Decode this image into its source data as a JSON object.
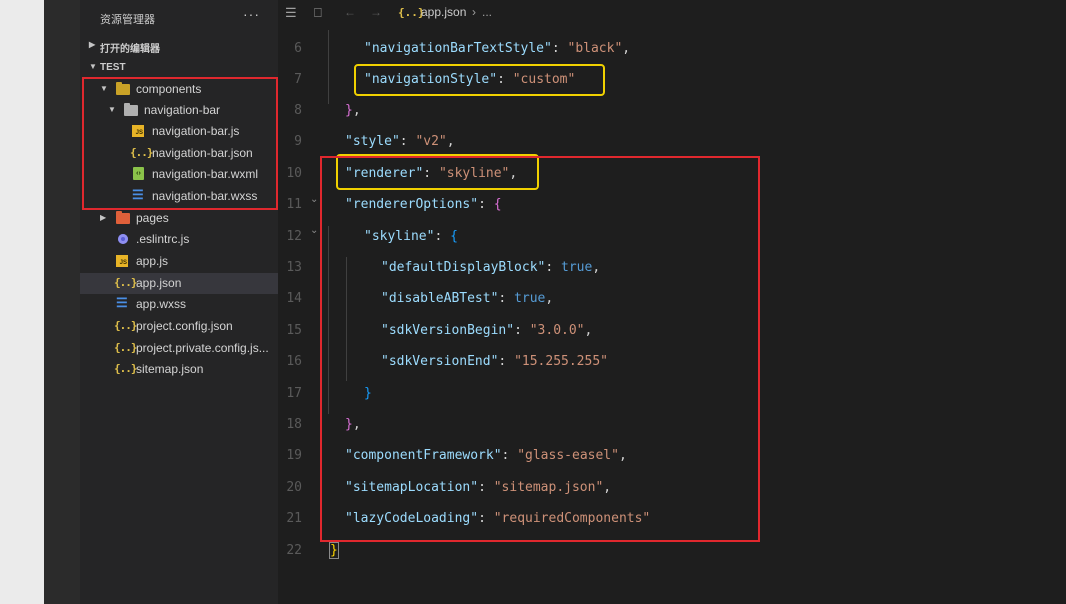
{
  "sidebar": {
    "title": "资源管理器",
    "more": "···",
    "open_editors": "打开的编辑器",
    "project": "TEST",
    "items": [
      {
        "name": "components"
      },
      {
        "name": "navigation-bar"
      },
      {
        "name": "navigation-bar.js"
      },
      {
        "name": "navigation-bar.json"
      },
      {
        "name": "navigation-bar.wxml"
      },
      {
        "name": "navigation-bar.wxss"
      },
      {
        "name": "pages"
      },
      {
        "name": ".eslintrc.js"
      },
      {
        "name": "app.js"
      },
      {
        "name": "app.json"
      },
      {
        "name": "app.wxss"
      },
      {
        "name": "project.config.json"
      },
      {
        "name": "project.private.config.js..."
      },
      {
        "name": "sitemap.json"
      }
    ]
  },
  "breadcrumb": {
    "file": "app.json",
    "sep": "›",
    "more": "..."
  },
  "code": {
    "lines": [
      "6",
      "7",
      "8",
      "9",
      "10",
      "11",
      "12",
      "13",
      "14",
      "15",
      "16",
      "17",
      "18",
      "19",
      "20",
      "21",
      "22"
    ],
    "l6": {
      "key": "\"navigationBarTextStyle\"",
      "val": "\"black\""
    },
    "l7": {
      "key": "\"navigationStyle\"",
      "val": "\"custom\""
    },
    "l9": {
      "key": "\"style\"",
      "val": "\"v2\""
    },
    "l10": {
      "key": "\"renderer\"",
      "val": "\"skyline\""
    },
    "l11": {
      "key": "\"rendererOptions\""
    },
    "l12": {
      "key": "\"skyline\""
    },
    "l13": {
      "key": "\"defaultDisplayBlock\"",
      "val": "true"
    },
    "l14": {
      "key": "\"disableABTest\"",
      "val": "true"
    },
    "l15": {
      "key": "\"sdkVersionBegin\"",
      "val": "\"3.0.0\""
    },
    "l16": {
      "key": "\"sdkVersionEnd\"",
      "val": "\"15.255.255\""
    },
    "l19": {
      "key": "\"componentFramework\"",
      "val": "\"glass-easel\""
    },
    "l20": {
      "key": "\"sitemapLocation\"",
      "val": "\"sitemap.json\""
    },
    "l21": {
      "key": "\"lazyCodeLoading\"",
      "val": "\"requiredComponents\""
    }
  }
}
